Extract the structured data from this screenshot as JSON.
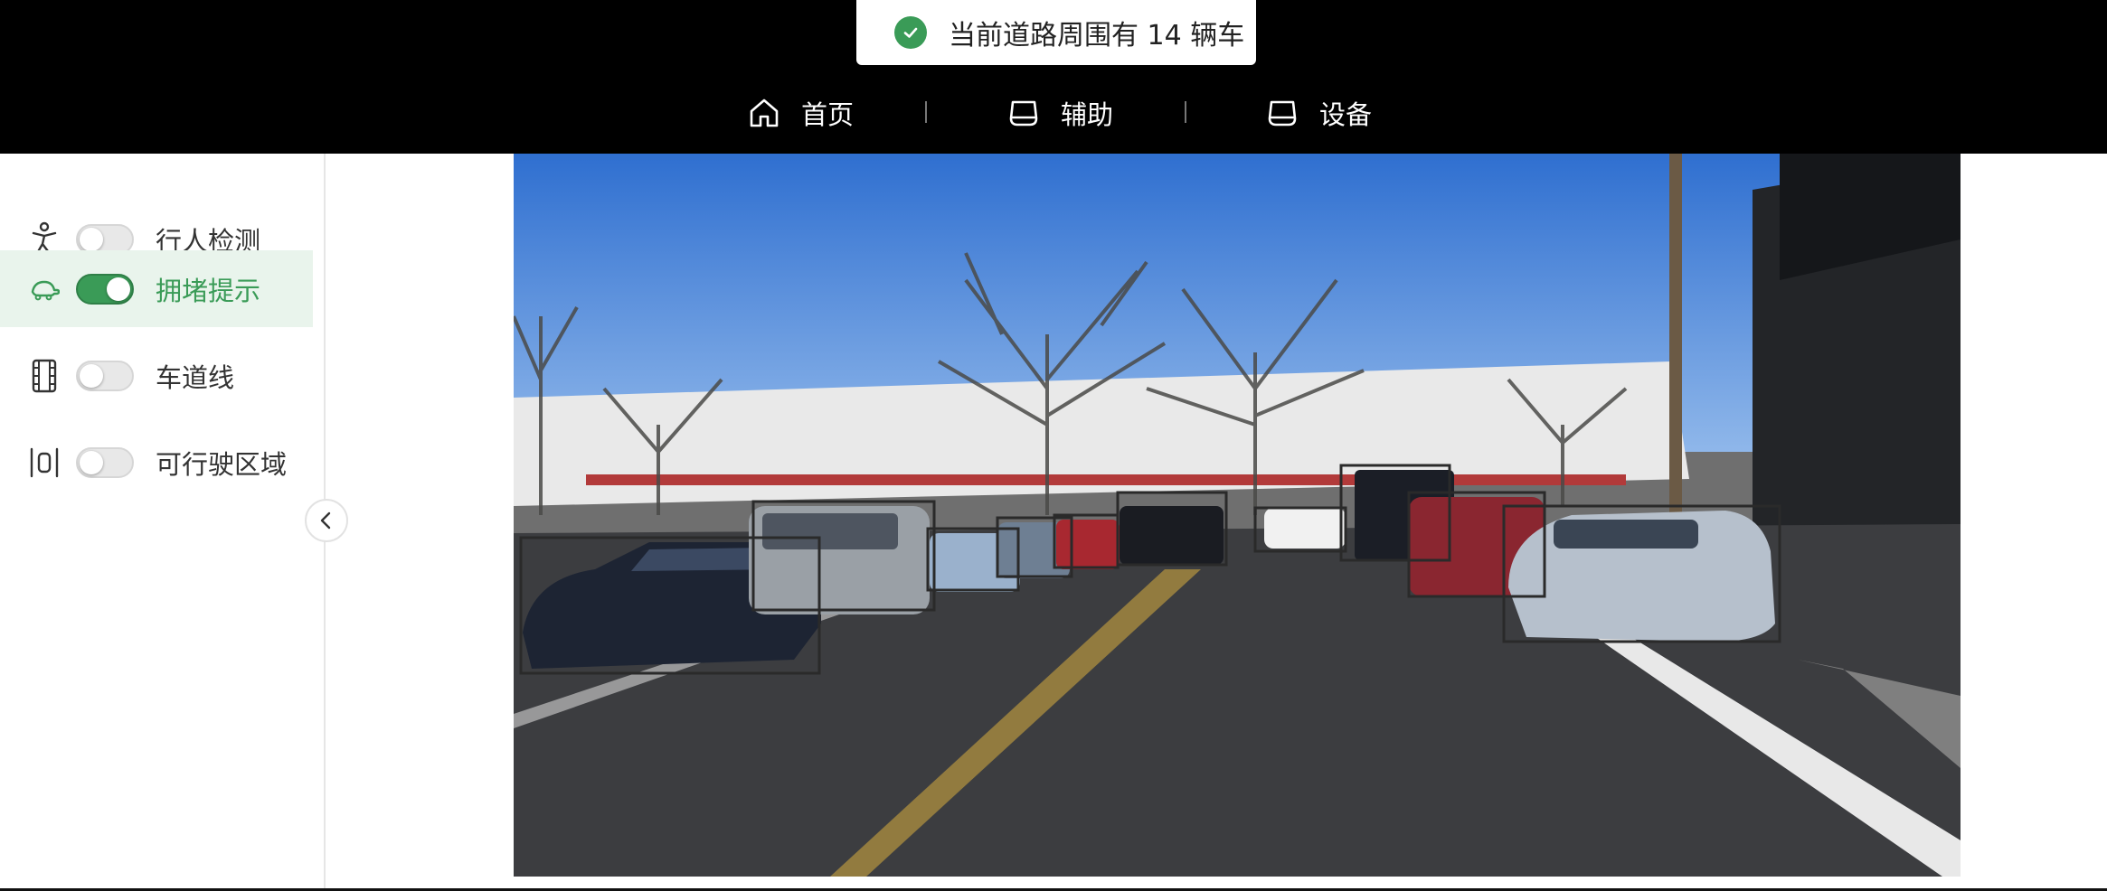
{
  "toast": {
    "message": "当前道路周围有 14 辆车",
    "icon": "check-circle-icon",
    "color": "#3a9b57"
  },
  "nav": {
    "items": [
      {
        "label": "首页",
        "icon": "home-icon"
      },
      {
        "label": "辅助",
        "icon": "tray-icon"
      },
      {
        "label": "设备",
        "icon": "tray-icon"
      }
    ]
  },
  "sidebar": {
    "items": [
      {
        "label": "行人检测",
        "icon": "pedestrian-icon",
        "enabled": false
      },
      {
        "label": "拥堵提示",
        "icon": "turtle-icon",
        "enabled": true
      },
      {
        "label": "车道线",
        "icon": "lane-line-icon",
        "enabled": false
      },
      {
        "label": "可行驶区域",
        "icon": "drivable-area-icon",
        "enabled": false
      }
    ],
    "collapse_icon": "chevron-left-icon"
  },
  "video": {
    "description_icon": "camera-feed",
    "detected_vehicles_shown": 14
  },
  "colors": {
    "accent": "#3a9b57",
    "topbar": "#000000",
    "active_bg": "#e9f4ec"
  }
}
